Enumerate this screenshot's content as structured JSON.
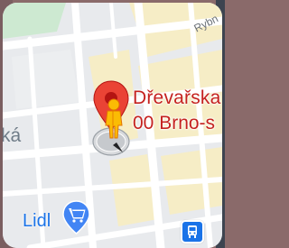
{
  "map": {
    "street_label": "Rybn",
    "district_label": "ká",
    "place": {
      "name_line1": "Dřevařska",
      "name_line2": "00 Brno-s"
    },
    "poi": {
      "lidl_label": "Lidl"
    }
  },
  "icons": {
    "red_pin": "location-pin-icon",
    "pegman": "street-view-pegman-icon",
    "compass": "direction-cone-icon",
    "lidl": "shopping-cart-pin-icon",
    "transit": "bus-stop-icon"
  },
  "colors": {
    "place_text": "#c5221f",
    "poi_text": "#1a73e8",
    "block_yellow": "#f6edc6",
    "road": "#ffffff",
    "map_bg": "#e8eaed"
  }
}
